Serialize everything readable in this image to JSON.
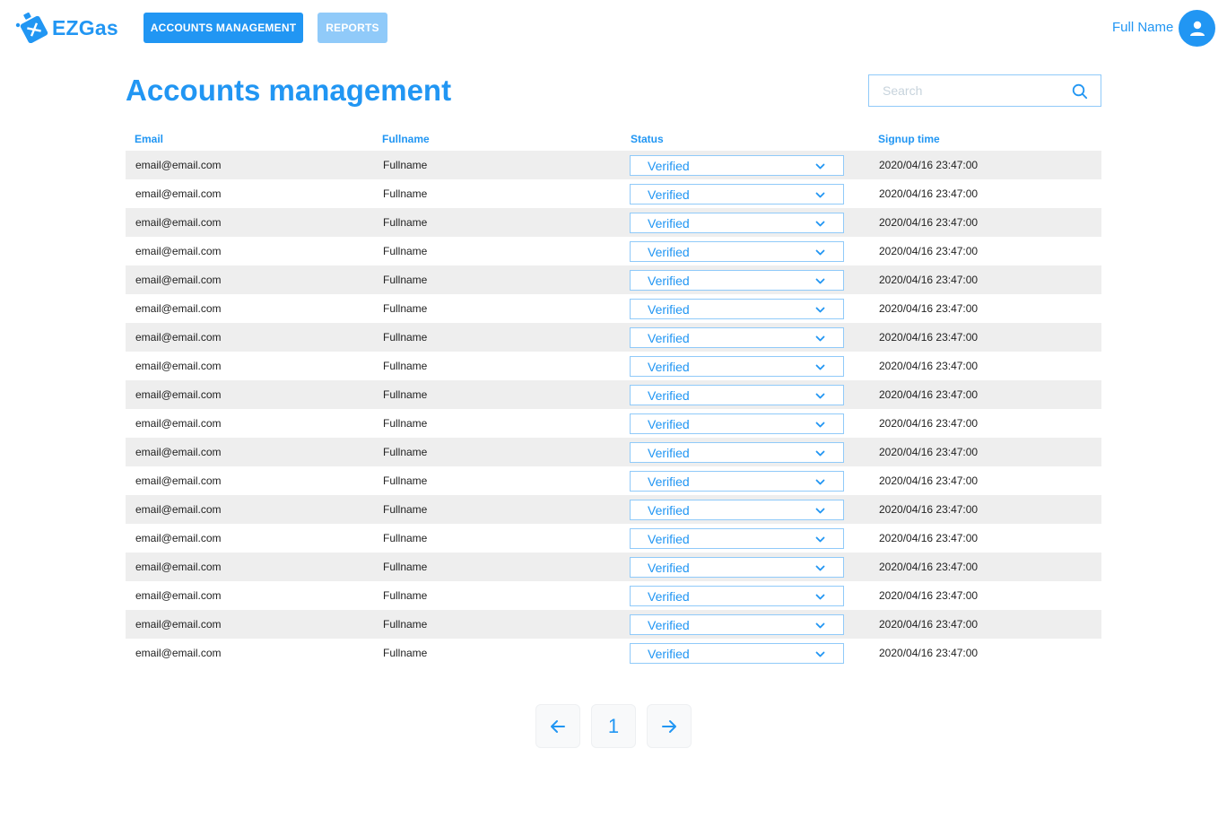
{
  "brand": {
    "name": "EZGas"
  },
  "nav": {
    "accounts": "ACCOUNTS MANAGEMENT",
    "reports": "REPORTS"
  },
  "user": {
    "name": "Full Name"
  },
  "page": {
    "title": "Accounts management"
  },
  "search": {
    "placeholder": "Search",
    "value": ""
  },
  "table": {
    "headers": [
      "Email",
      "Fullname",
      "Status",
      "Signup time"
    ],
    "rows": [
      {
        "email": "email@email.com",
        "fullname": "Fullname",
        "status": "Verified",
        "signup_time": "2020/04/16 23:47:00"
      },
      {
        "email": "email@email.com",
        "fullname": "Fullname",
        "status": "Verified",
        "signup_time": "2020/04/16 23:47:00"
      },
      {
        "email": "email@email.com",
        "fullname": "Fullname",
        "status": "Verified",
        "signup_time": "2020/04/16 23:47:00"
      },
      {
        "email": "email@email.com",
        "fullname": "Fullname",
        "status": "Verified",
        "signup_time": "2020/04/16 23:47:00"
      },
      {
        "email": "email@email.com",
        "fullname": "Fullname",
        "status": "Verified",
        "signup_time": "2020/04/16 23:47:00"
      },
      {
        "email": "email@email.com",
        "fullname": "Fullname",
        "status": "Verified",
        "signup_time": "2020/04/16 23:47:00"
      },
      {
        "email": "email@email.com",
        "fullname": "Fullname",
        "status": "Verified",
        "signup_time": "2020/04/16 23:47:00"
      },
      {
        "email": "email@email.com",
        "fullname": "Fullname",
        "status": "Verified",
        "signup_time": "2020/04/16 23:47:00"
      },
      {
        "email": "email@email.com",
        "fullname": "Fullname",
        "status": "Verified",
        "signup_time": "2020/04/16 23:47:00"
      },
      {
        "email": "email@email.com",
        "fullname": "Fullname",
        "status": "Verified",
        "signup_time": "2020/04/16 23:47:00"
      },
      {
        "email": "email@email.com",
        "fullname": "Fullname",
        "status": "Verified",
        "signup_time": "2020/04/16 23:47:00"
      },
      {
        "email": "email@email.com",
        "fullname": "Fullname",
        "status": "Verified",
        "signup_time": "2020/04/16 23:47:00"
      },
      {
        "email": "email@email.com",
        "fullname": "Fullname",
        "status": "Verified",
        "signup_time": "2020/04/16 23:47:00"
      },
      {
        "email": "email@email.com",
        "fullname": "Fullname",
        "status": "Verified",
        "signup_time": "2020/04/16 23:47:00"
      },
      {
        "email": "email@email.com",
        "fullname": "Fullname",
        "status": "Verified",
        "signup_time": "2020/04/16 23:47:00"
      },
      {
        "email": "email@email.com",
        "fullname": "Fullname",
        "status": "Verified",
        "signup_time": "2020/04/16 23:47:00"
      },
      {
        "email": "email@email.com",
        "fullname": "Fullname",
        "status": "Verified",
        "signup_time": "2020/04/16 23:47:00"
      },
      {
        "email": "email@email.com",
        "fullname": "Fullname",
        "status": "Verified",
        "signup_time": "2020/04/16 23:47:00"
      }
    ]
  },
  "pagination": {
    "current_page": "1"
  },
  "icons": {
    "logo": "gas-can-icon",
    "avatar": "user-icon",
    "search": "search-icon",
    "dropdown": "chevron-down-icon",
    "prev": "arrow-left-icon",
    "next": "arrow-right-icon"
  },
  "colors": {
    "primary": "#2196f3",
    "primary_light": "#90caf9",
    "row_alt": "#eeeeee"
  }
}
